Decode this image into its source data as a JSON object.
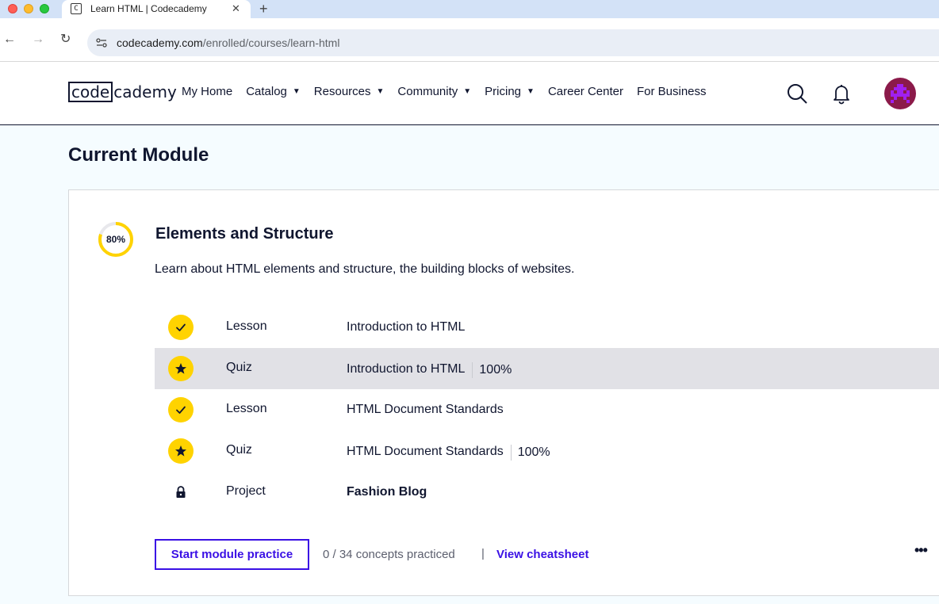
{
  "browser": {
    "tab_title": "Learn HTML | Codecademy",
    "favicon_text": "C",
    "tab_close": "✕",
    "new_tab": "+",
    "url_host": "codecademy.com",
    "url_path": "/enrolled/courses/learn-html",
    "back": "←",
    "forward": "→",
    "reload": "↻"
  },
  "header": {
    "logo_code": "code",
    "logo_rest": "cademy",
    "nav": [
      {
        "label": "My Home",
        "caret": ""
      },
      {
        "label": "Catalog",
        "caret": "▼"
      },
      {
        "label": "Resources",
        "caret": "▼"
      },
      {
        "label": "Community",
        "caret": "▼"
      },
      {
        "label": "Pricing",
        "caret": "▼"
      },
      {
        "label": "Career Center",
        "caret": ""
      },
      {
        "label": "For Business",
        "caret": ""
      }
    ],
    "icons": [
      "search-icon",
      "bell-icon",
      "avatar"
    ]
  },
  "main": {
    "page_title": "Current Module",
    "module": {
      "progress_label": "80%",
      "progress_value": 0.8,
      "title": "Elements and Structure",
      "description": "Learn about HTML elements and structure, the building blocks of websites.",
      "items": [
        {
          "type": "Lesson",
          "title": "Introduction to HTML",
          "score": "",
          "status": "check-icon",
          "highlighted": false,
          "bold": false
        },
        {
          "type": "Quiz",
          "title": "Introduction to HTML",
          "score": "100%",
          "status": "star-icon",
          "highlighted": true,
          "bold": false
        },
        {
          "type": "Lesson",
          "title": "HTML Document Standards",
          "score": "",
          "status": "check-icon",
          "highlighted": false,
          "bold": false
        },
        {
          "type": "Quiz",
          "title": "HTML Document Standards",
          "score": "100%",
          "status": "star-icon",
          "highlighted": false,
          "bold": false
        },
        {
          "type": "Project",
          "title": "Fashion Blog",
          "score": "",
          "status": "lock-icon",
          "highlighted": false,
          "bold": true
        }
      ],
      "practice_button": "Start module practice",
      "concepts_text": "0 / 34 concepts practiced",
      "separator": "|",
      "cheatsheet_link": "View cheatsheet",
      "more_menu": "•••"
    }
  },
  "colors": {
    "accent": "#3a10e5",
    "progress": "#ffd300",
    "text": "#10162f",
    "background": "#f5fcff"
  }
}
